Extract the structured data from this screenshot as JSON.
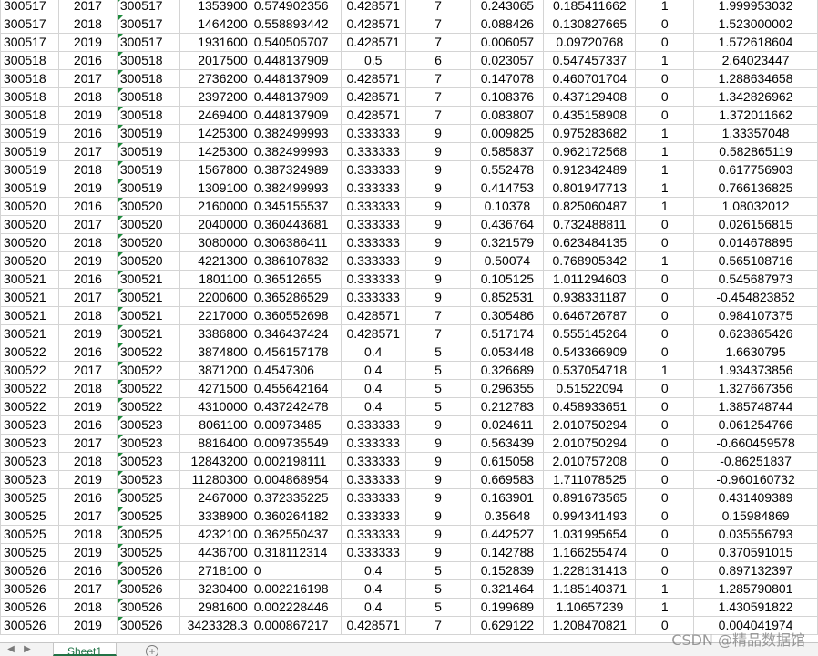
{
  "sheet": {
    "rows": [
      [
        "300517",
        "2017",
        "300517",
        "1353900",
        "0.574902356",
        "0.428571",
        "7",
        "0.243065",
        "0.185411662",
        "1",
        "1.999953032"
      ],
      [
        "300517",
        "2018",
        "300517",
        "1464200",
        "0.558893442",
        "0.428571",
        "7",
        "0.088426",
        "0.130827665",
        "0",
        "1.523000002"
      ],
      [
        "300517",
        "2019",
        "300517",
        "1931600",
        "0.540505707",
        "0.428571",
        "7",
        "0.006057",
        "0.09720768",
        "0",
        "1.572618604"
      ],
      [
        "300518",
        "2016",
        "300518",
        "2017500",
        "0.448137909",
        "0.5",
        "6",
        "0.023057",
        "0.547457337",
        "1",
        "2.64023447"
      ],
      [
        "300518",
        "2017",
        "300518",
        "2736200",
        "0.448137909",
        "0.428571",
        "7",
        "0.147078",
        "0.460701704",
        "0",
        "1.288634658"
      ],
      [
        "300518",
        "2018",
        "300518",
        "2397200",
        "0.448137909",
        "0.428571",
        "7",
        "0.108376",
        "0.437129408",
        "0",
        "1.342826962"
      ],
      [
        "300518",
        "2019",
        "300518",
        "2469400",
        "0.448137909",
        "0.428571",
        "7",
        "0.083807",
        "0.435158908",
        "0",
        "1.372011662"
      ],
      [
        "300519",
        "2016",
        "300519",
        "1425300",
        "0.382499993",
        "0.333333",
        "9",
        "0.009825",
        "0.975283682",
        "1",
        "1.33357048"
      ],
      [
        "300519",
        "2017",
        "300519",
        "1425300",
        "0.382499993",
        "0.333333",
        "9",
        "0.585837",
        "0.962172568",
        "1",
        "0.582865119"
      ],
      [
        "300519",
        "2018",
        "300519",
        "1567800",
        "0.387324989",
        "0.333333",
        "9",
        "0.552478",
        "0.912342489",
        "1",
        "0.617756903"
      ],
      [
        "300519",
        "2019",
        "300519",
        "1309100",
        "0.382499993",
        "0.333333",
        "9",
        "0.414753",
        "0.801947713",
        "1",
        "0.766136825"
      ],
      [
        "300520",
        "2016",
        "300520",
        "2160000",
        "0.345155537",
        "0.333333",
        "9",
        "0.10378",
        "0.825060487",
        "1",
        "1.08032012"
      ],
      [
        "300520",
        "2017",
        "300520",
        "2040000",
        "0.360443681",
        "0.333333",
        "9",
        "0.436764",
        "0.732488811",
        "0",
        "0.026156815"
      ],
      [
        "300520",
        "2018",
        "300520",
        "3080000",
        "0.306386411",
        "0.333333",
        "9",
        "0.321579",
        "0.623484135",
        "0",
        "0.014678895"
      ],
      [
        "300520",
        "2019",
        "300520",
        "4221300",
        "0.386107832",
        "0.333333",
        "9",
        "0.50074",
        "0.768905342",
        "1",
        "0.565108716"
      ],
      [
        "300521",
        "2016",
        "300521",
        "1801100",
        "0.36512655",
        "0.333333",
        "9",
        "0.105125",
        "1.011294603",
        "0",
        "0.545687973"
      ],
      [
        "300521",
        "2017",
        "300521",
        "2200600",
        "0.365286529",
        "0.333333",
        "9",
        "0.852531",
        "0.938331187",
        "0",
        "-0.454823852"
      ],
      [
        "300521",
        "2018",
        "300521",
        "2217000",
        "0.360552698",
        "0.428571",
        "7",
        "0.305486",
        "0.646726787",
        "0",
        "0.984107375"
      ],
      [
        "300521",
        "2019",
        "300521",
        "3386800",
        "0.346437424",
        "0.428571",
        "7",
        "0.517174",
        "0.555145264",
        "0",
        "0.623865426"
      ],
      [
        "300522",
        "2016",
        "300522",
        "3874800",
        "0.456157178",
        "0.4",
        "5",
        "0.053448",
        "0.543366909",
        "0",
        "1.6630795"
      ],
      [
        "300522",
        "2017",
        "300522",
        "3871200",
        "0.4547306",
        "0.4",
        "5",
        "0.326689",
        "0.537054718",
        "1",
        "1.934373856"
      ],
      [
        "300522",
        "2018",
        "300522",
        "4271500",
        "0.455642164",
        "0.4",
        "5",
        "0.296355",
        "0.51522094",
        "0",
        "1.327667356"
      ],
      [
        "300522",
        "2019",
        "300522",
        "4310000",
        "0.437242478",
        "0.4",
        "5",
        "0.212783",
        "0.458933651",
        "0",
        "1.385748744"
      ],
      [
        "300523",
        "2016",
        "300523",
        "8061100",
        "0.00973485",
        "0.333333",
        "9",
        "0.024611",
        "2.010750294",
        "0",
        "0.061254766"
      ],
      [
        "300523",
        "2017",
        "300523",
        "8816400",
        "0.009735549",
        "0.333333",
        "9",
        "0.563439",
        "2.010750294",
        "0",
        "-0.660459578"
      ],
      [
        "300523",
        "2018",
        "300523",
        "12843200",
        "0.002198111",
        "0.333333",
        "9",
        "0.615058",
        "2.010757208",
        "0",
        "-0.86251837"
      ],
      [
        "300523",
        "2019",
        "300523",
        "11280300",
        "0.004868954",
        "0.333333",
        "9",
        "0.669583",
        "1.711078525",
        "0",
        "-0.960160732"
      ],
      [
        "300525",
        "2016",
        "300525",
        "2467000",
        "0.372335225",
        "0.333333",
        "9",
        "0.163901",
        "0.891673565",
        "0",
        "0.431409389"
      ],
      [
        "300525",
        "2017",
        "300525",
        "3338900",
        "0.360264182",
        "0.333333",
        "9",
        "0.35648",
        "0.994341493",
        "0",
        "0.15984869"
      ],
      [
        "300525",
        "2018",
        "300525",
        "4232100",
        "0.362550437",
        "0.333333",
        "9",
        "0.442527",
        "1.031995654",
        "0",
        "0.035556793"
      ],
      [
        "300525",
        "2019",
        "300525",
        "4436700",
        "0.318112314",
        "0.333333",
        "9",
        "0.142788",
        "1.166255474",
        "0",
        "0.370591015"
      ],
      [
        "300526",
        "2016",
        "300526",
        "2718100",
        "0",
        "0.4",
        "5",
        "0.152839",
        "1.228131413",
        "0",
        "0.897132397"
      ],
      [
        "300526",
        "2017",
        "300526",
        "3230400",
        "0.002216198",
        "0.4",
        "5",
        "0.321464",
        "1.185140371",
        "1",
        "1.285790801"
      ],
      [
        "300526",
        "2018",
        "300526",
        "2981600",
        "0.002228446",
        "0.4",
        "5",
        "0.199689",
        "1.10657239",
        "1",
        "1.430591822"
      ],
      [
        "300526",
        "2019",
        "300526",
        "3423328.3",
        "0.000867217",
        "0.428571",
        "7",
        "0.629122",
        "1.208470821",
        "0",
        "0.004041974"
      ]
    ]
  },
  "tabs": {
    "prev_icon": "chevron-left-icon",
    "next_icon": "chevron-right-icon",
    "active_tab": "Sheet1",
    "add_icon": "plus-circle-icon"
  },
  "watermark": "CSDN @精品数据馆",
  "colors": {
    "grid_line": "#d4d4d4",
    "error_indicator": "#1e8a3c",
    "tab_accent": "#217346"
  }
}
